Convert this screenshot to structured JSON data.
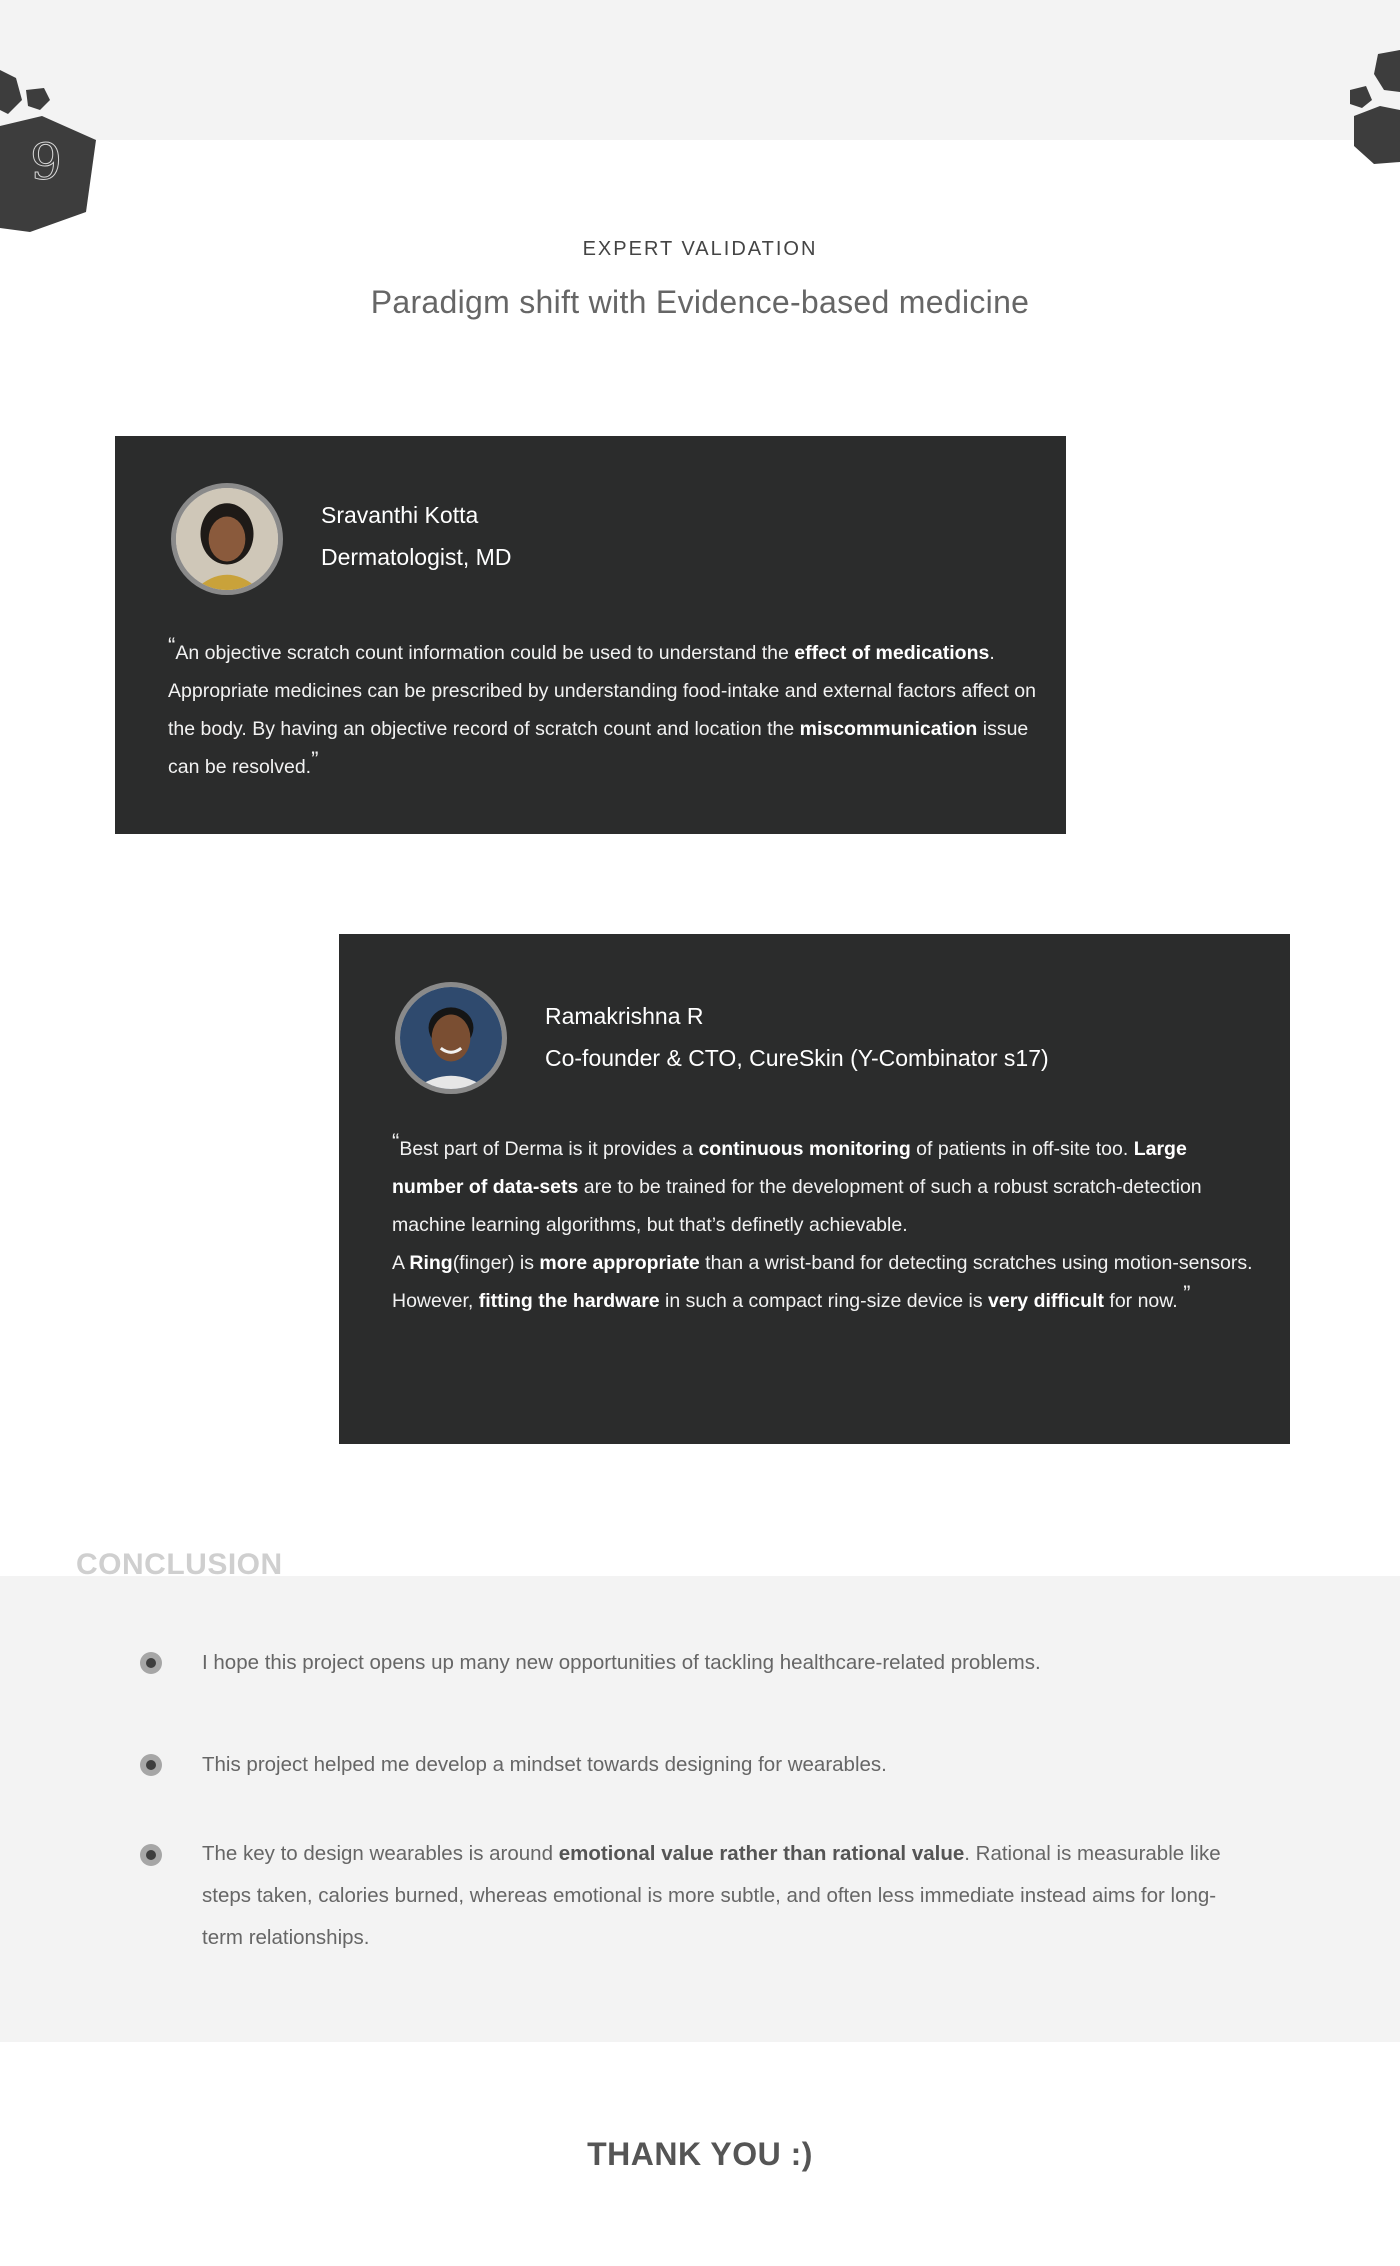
{
  "section_number": "9",
  "header": {
    "eyebrow": "EXPERT VALIDATION",
    "headline": "Paradigm shift with Evidence-based medicine"
  },
  "testimonials": [
    {
      "name": "Sravanthi Kotta",
      "role": "Dermatologist, MD",
      "quote": [
        {
          "t": "An objective scratch count information could be used to understand the "
        },
        {
          "t": "effect of medications",
          "b": true
        },
        {
          "t": ". Appropriate medicines can be prescribed by understanding food-intake and external factors affect on the body. By having an objective record of scratch count and location the "
        },
        {
          "t": "miscommunication",
          "b": true
        },
        {
          "t": " issue can be resolved."
        }
      ]
    },
    {
      "name": "Ramakrishna R",
      "role": "Co-founder & CTO, CureSkin (Y-Combinator s17)",
      "quote": [
        {
          "t": "Best part of Derma is it provides a "
        },
        {
          "t": "continuous monitoring",
          "b": true
        },
        {
          "t": " of patients in off-site too. "
        },
        {
          "t": "Large number of data-sets",
          "b": true
        },
        {
          "t": " are to be trained for the development of such a robust scratch-detection machine learning algorithms, but that’s definetly achievable."
        },
        {
          "br": true
        },
        {
          "t": "A "
        },
        {
          "t": "Ring",
          "b": true
        },
        {
          "t": "(finger) is "
        },
        {
          "t": "more appropriate",
          "b": true
        },
        {
          "t": " than a wrist-band for detecting scratches using motion-sensors. However, "
        },
        {
          "t": "fitting the hardware",
          "b": true
        },
        {
          "t": " in such a compact ring-size device is "
        },
        {
          "t": "very difficult",
          "b": true
        },
        {
          "t": " for now.  "
        }
      ]
    }
  ],
  "conclusion": {
    "title": "CONCLUSION",
    "points": [
      [
        {
          "t": "I hope this project opens up many new opportunities of tackling healthcare-related problems."
        }
      ],
      [
        {
          "t": "This project helped me develop a mindset towards designing for wearables."
        }
      ],
      [
        {
          "t": "The key to design wearables is around "
        },
        {
          "t": "emotional value rather than rational value",
          "b": true
        },
        {
          "t": ". Rational is measurable like steps taken, calories burned, whereas emotional is more subtle, and often less immediate instead aims for long-term relationships."
        }
      ]
    ]
  },
  "closing": "THANK YOU :)",
  "colors": {
    "card_background": "#2b2c2c",
    "band_background": "#f3f3f3",
    "decoration": "#3d3d3d"
  }
}
